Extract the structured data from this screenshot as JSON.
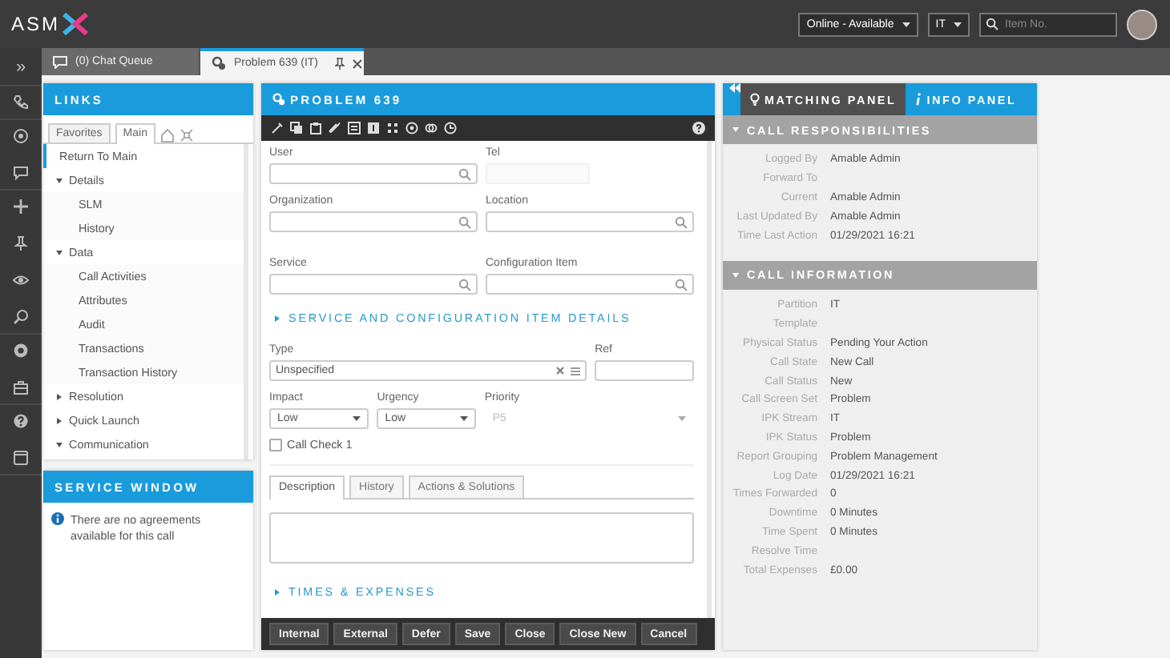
{
  "top_bar": {
    "logo_text": "ASM",
    "status_select": "Online - Available",
    "partition_select": "IT",
    "search": {
      "placeholder": "Item No."
    }
  },
  "rail": {
    "expand_glyph": "»"
  },
  "document_tabs": [
    {
      "label": "(0) Chat Queue",
      "selected": false,
      "kind": "chat"
    },
    {
      "label": "Problem 639 (IT)",
      "selected": true,
      "kind": "problem"
    }
  ],
  "links_panel": {
    "title": "LINKS",
    "tabs": [
      {
        "label": "Favorites",
        "selected": false
      },
      {
        "label": "Main",
        "selected": true
      }
    ],
    "tree": [
      {
        "label": "Return To Main",
        "selected": true
      },
      {
        "label": "Details",
        "expanded": true,
        "children": [
          {
            "label": "SLM",
            "selected": false
          },
          {
            "label": "History",
            "selected": false
          }
        ]
      },
      {
        "label": "Data",
        "expanded": true,
        "children": [
          {
            "label": "Call Activities",
            "selected": false
          },
          {
            "label": "Attributes",
            "selected": false
          },
          {
            "label": "Audit",
            "selected": false
          },
          {
            "label": "Transactions",
            "selected": false
          },
          {
            "label": "Transaction History",
            "selected": false
          }
        ]
      },
      {
        "label": "Resolution",
        "expanded": false
      },
      {
        "label": "Quick Launch",
        "expanded": false
      },
      {
        "label": "Communication",
        "expanded": true
      }
    ]
  },
  "service_window": {
    "title": "SERVICE WINDOW",
    "message": "There are no agreements available for this call"
  },
  "problem_panel": {
    "title": "PROBLEM 639",
    "rows": [
      [
        {
          "label": "User",
          "kind": "lookup"
        },
        {
          "label": "Tel",
          "kind": "plain"
        }
      ],
      [
        {
          "label": "Organization",
          "kind": "lookup"
        },
        {
          "label": "Location",
          "kind": "lookup"
        }
      ],
      [
        {
          "label": "Service",
          "kind": "lookup"
        },
        {
          "label": "Configuration Item",
          "kind": "lookup"
        }
      ]
    ],
    "section_1": {
      "title": "SERVICE AND CONFIGURATION ITEM DETAILS",
      "expanded": false
    },
    "type_row": [
      {
        "label": "Type",
        "kind": "picker",
        "value": "Unspecified"
      },
      {
        "label": "Ref",
        "kind": "text"
      }
    ],
    "select_row": [
      {
        "label": "Impact",
        "value": "Low",
        "disabled": false
      },
      {
        "label": "Urgency",
        "value": "Low",
        "disabled": false
      },
      {
        "label": "Priority",
        "value": "P5",
        "disabled": true
      }
    ],
    "checkbox": {
      "label": "Call Check 1",
      "checked": false
    },
    "tabs": [
      {
        "label": "Description",
        "selected": true
      },
      {
        "label": "History",
        "selected": false
      },
      {
        "label": "Actions & Solutions",
        "selected": false
      }
    ],
    "section_2": {
      "title": "TIMES & EXPENSES",
      "expanded": false
    },
    "buttons": [
      "Internal",
      "External",
      "Defer",
      "Save",
      "Close",
      "Close New",
      "Cancel"
    ]
  },
  "info_panel": {
    "tabs": [
      {
        "label": "MATCHING PANEL",
        "selected": false,
        "kind": "matching"
      },
      {
        "label": "INFO PANEL",
        "selected": true,
        "kind": "info"
      }
    ],
    "sections": [
      {
        "title": "CALL RESPONSIBILITIES",
        "expanded": true,
        "rows": [
          {
            "label": "Logged By",
            "value": "Amable Admin"
          },
          {
            "label": "Forward To"
          },
          {
            "label": "Current",
            "value": "Amable Admin"
          },
          {
            "label": "Last Updated By",
            "value": "Amable Admin"
          },
          {
            "label": "Time Last Action",
            "value": "01/29/2021 16:21"
          }
        ]
      },
      {
        "title": "CALL INFORMATION",
        "expanded": true,
        "rows": [
          {
            "label": "Partition",
            "value": "IT"
          },
          {
            "label": "Template"
          },
          {
            "label": "Physical Status",
            "value": "Pending Your Action"
          },
          {
            "label": "Call State",
            "value": "New Call"
          },
          {
            "label": "Call Status",
            "value": "New"
          },
          {
            "label": "Call Screen Set",
            "value": "Problem"
          },
          {
            "label": "IPK Stream",
            "value": "IT"
          },
          {
            "label": "IPK Status",
            "value": "Problem"
          },
          {
            "label": "Report Grouping",
            "value": "Problem Management"
          },
          {
            "label": "Log Date",
            "value": "01/29/2021 16:21"
          },
          {
            "label": "Times Forwarded",
            "value": "0"
          },
          {
            "label": "Downtime",
            "value": "0 Minutes"
          },
          {
            "label": "Time Spent",
            "value": "0 Minutes"
          },
          {
            "label": "Resolve Time"
          },
          {
            "label": "Total Expenses",
            "value": "£0.00"
          }
        ]
      }
    ]
  }
}
